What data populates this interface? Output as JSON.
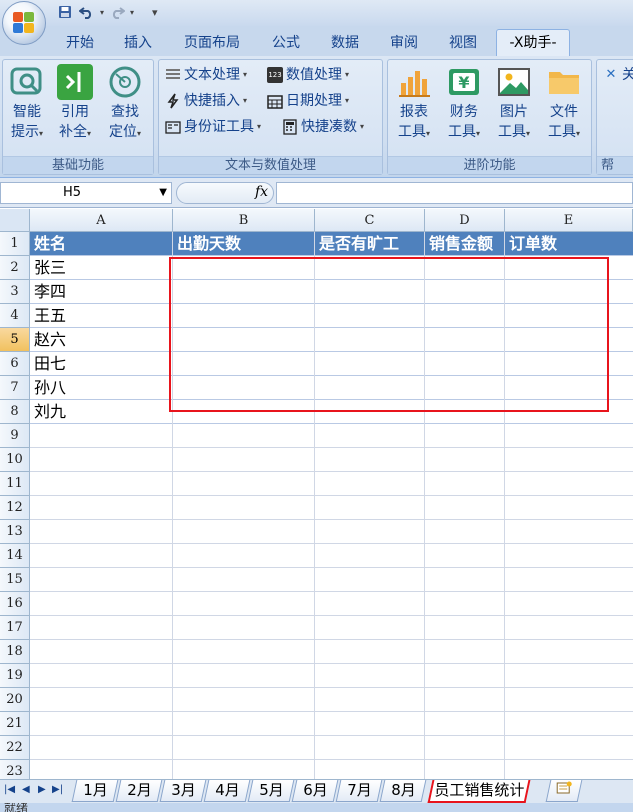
{
  "qat": {
    "save": "save-icon",
    "undo": "undo-icon",
    "redo": "redo-icon"
  },
  "tabs": [
    "开始",
    "插入",
    "页面布局",
    "公式",
    "数据",
    "审阅",
    "视图",
    "-X助手-"
  ],
  "ribbon": {
    "group1": {
      "label": "基础功能",
      "buttons": [
        {
          "line1": "智能",
          "line2": "提示"
        },
        {
          "line1": "引用",
          "line2": "补全"
        },
        {
          "line1": "查找",
          "line2": "定位"
        }
      ]
    },
    "group2": {
      "label": "文本与数值处理",
      "items": [
        "文本处理",
        "数值处理",
        "快捷插入",
        "日期处理",
        "身份证工具",
        "快捷凑数"
      ]
    },
    "group3": {
      "label": "进阶功能",
      "buttons": [
        {
          "line1": "报表",
          "line2": "工具"
        },
        {
          "line1": "财务",
          "line2": "工具"
        },
        {
          "line1": "图片",
          "line2": "工具"
        },
        {
          "line1": "文件",
          "line2": "工具"
        }
      ]
    },
    "group4": {
      "label": "帮",
      "top": "关"
    }
  },
  "formula_bar": {
    "name_box": "H5",
    "fx": "fx",
    "value": ""
  },
  "grid": {
    "columns": [
      "A",
      "B",
      "C",
      "D",
      "E"
    ],
    "rows": [
      "1",
      "2",
      "3",
      "4",
      "5",
      "6",
      "7",
      "8",
      "9",
      "10",
      "11",
      "12",
      "13",
      "14",
      "15",
      "16",
      "17",
      "18",
      "19",
      "20",
      "21",
      "22",
      "23"
    ],
    "active_row": "5",
    "headers": [
      "姓名",
      "出勤天数",
      "是否有旷工",
      "销售金额",
      "订单数"
    ],
    "names": [
      "张三",
      "李四",
      "王五",
      "赵六",
      "田七",
      "孙八",
      "刘九"
    ]
  },
  "sheets": [
    "1月",
    "2月",
    "3月",
    "4月",
    "5月",
    "6月",
    "7月",
    "8月",
    "员工销售统计"
  ],
  "active_sheet": "员工销售统计",
  "status": "就绪",
  "colors": {
    "header_band": "#4f81bd",
    "highlight": "#e8141c",
    "active_row": "#f1c15f"
  }
}
